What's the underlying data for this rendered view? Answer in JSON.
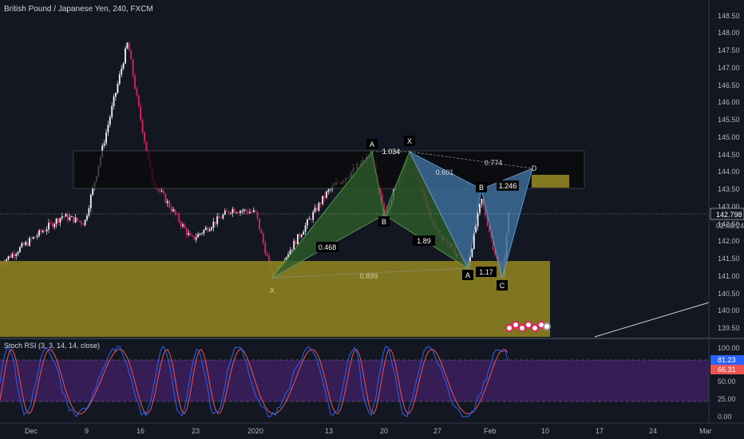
{
  "header": {
    "symbol_title": "British Pound / Japanese Yen, 240, FXCM",
    "rsi_title": "Stoch RSI (3, 3, 14, 14, close)"
  },
  "price_axis": {
    "ticks": [
      "148.50",
      "148.00",
      "147.50",
      "147.00",
      "146.50",
      "146.00",
      "145.50",
      "145.00",
      "144.50",
      "144.00",
      "143.50",
      "143.00",
      "142.50",
      "142.00",
      "141.50",
      "141.00",
      "140.50",
      "140.00",
      "139.50"
    ],
    "last_price": "142.798",
    "countdown": "02:08:24"
  },
  "rsi_axis": {
    "ticks": [
      "100.00",
      "75.00",
      "50.00",
      "25.00",
      "0.00"
    ],
    "k_value": "81.23",
    "d_value": "66.31"
  },
  "time_axis": {
    "ticks": [
      "Dec",
      "9",
      "16",
      "23",
      "2020",
      "13",
      "20",
      "27",
      "Feb",
      "10",
      "17",
      "24",
      "Mar"
    ]
  },
  "pattern1": {
    "points": [
      "X",
      "A",
      "B"
    ],
    "ratios": [
      "0.468",
      "0.899",
      "1.034",
      "1.89"
    ]
  },
  "pattern2": {
    "points": [
      "X",
      "A",
      "B",
      "C",
      "D"
    ],
    "ratios": [
      "0.601",
      "0.774",
      "1.17",
      "1.246"
    ]
  },
  "colors": {
    "background": "#131722",
    "up_candle": "#f5f5f5",
    "down_candle": "#e0245e",
    "support_zone": "#8a7f22",
    "resistance_zone": "#0a0a0a",
    "bull_pattern": "#2e5d2a",
    "bear_pattern": "#3d6c98",
    "rsi_band": "#3b1e5c",
    "rsi_k": "#2962ff",
    "rsi_d": "#ef5350"
  },
  "chart_data": {
    "type": "candlestick",
    "title": "British Pound / Japanese Yen, 240, FXCM",
    "ylim": [
      139.3,
      148.9
    ],
    "last_price": 142.798,
    "approx_close_path": [
      {
        "x": "Dec",
        "y": 141.4
      },
      {
        "x": "5",
        "y": 142.8
      },
      {
        "x": "9",
        "y": 142.6
      },
      {
        "x": "13",
        "y": 147.9
      },
      {
        "x": "16",
        "y": 146.3
      },
      {
        "x": "18",
        "y": 143.9
      },
      {
        "x": "23",
        "y": 142.1
      },
      {
        "x": "27",
        "y": 143.0
      },
      {
        "x": "2020",
        "y": 142.9
      },
      {
        "x": "3",
        "y": 141.0
      },
      {
        "x": "9",
        "y": 143.5
      },
      {
        "x": "16",
        "y": 144.6
      },
      {
        "x": "20",
        "y": 142.8
      },
      {
        "x": "23",
        "y": 144.6
      },
      {
        "x": "27",
        "y": 142.5
      },
      {
        "x": "31",
        "y": 141.3
      },
      {
        "x": "Feb",
        "y": 143.3
      },
      {
        "x": "4",
        "y": 140.9
      },
      {
        "x": "6",
        "y": 142.8
      }
    ]
  }
}
